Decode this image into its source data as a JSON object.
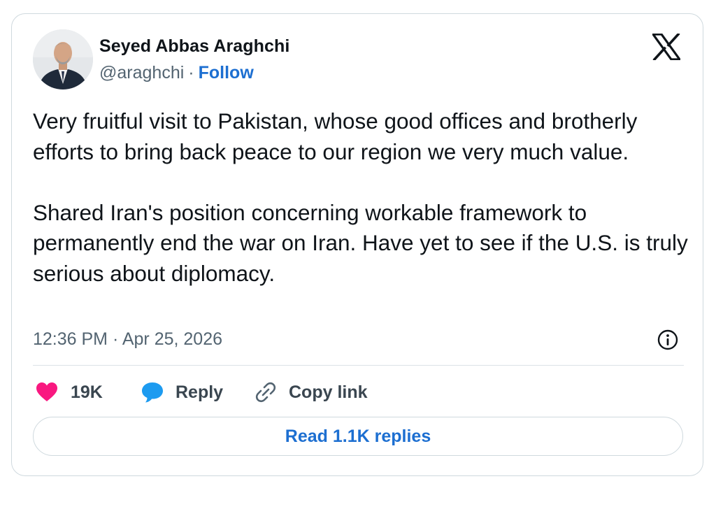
{
  "author": {
    "name": "Seyed Abbas Araghchi",
    "handle": "@araghchi",
    "separator": "·",
    "follow_label": "Follow"
  },
  "tweet": {
    "text": "Very fruitful visit to Pakistan, whose good offices and brotherly efforts to bring back peace to our region we very much value.\n\nShared Iran's position concerning workable framework to permanently end the war on Iran. Have yet to see if the U.S. is truly serious about diplomacy.",
    "timestamp": "12:36 PM · Apr 25, 2026"
  },
  "actions": {
    "like_count": "19K",
    "reply_label": "Reply",
    "copy_link_label": "Copy link"
  },
  "read_replies_label": "Read 1.1K replies",
  "icons": {
    "platform_logo": "x-logo-icon",
    "info": "info-icon",
    "like": "heart-icon",
    "reply": "speech-bubble-icon",
    "copy_link": "link-icon"
  },
  "colors": {
    "like": "#f91880",
    "reply": "#1d9bf0",
    "link_blue": "#1d6fd1",
    "secondary_text": "#536471",
    "border": "#cfd9de"
  }
}
